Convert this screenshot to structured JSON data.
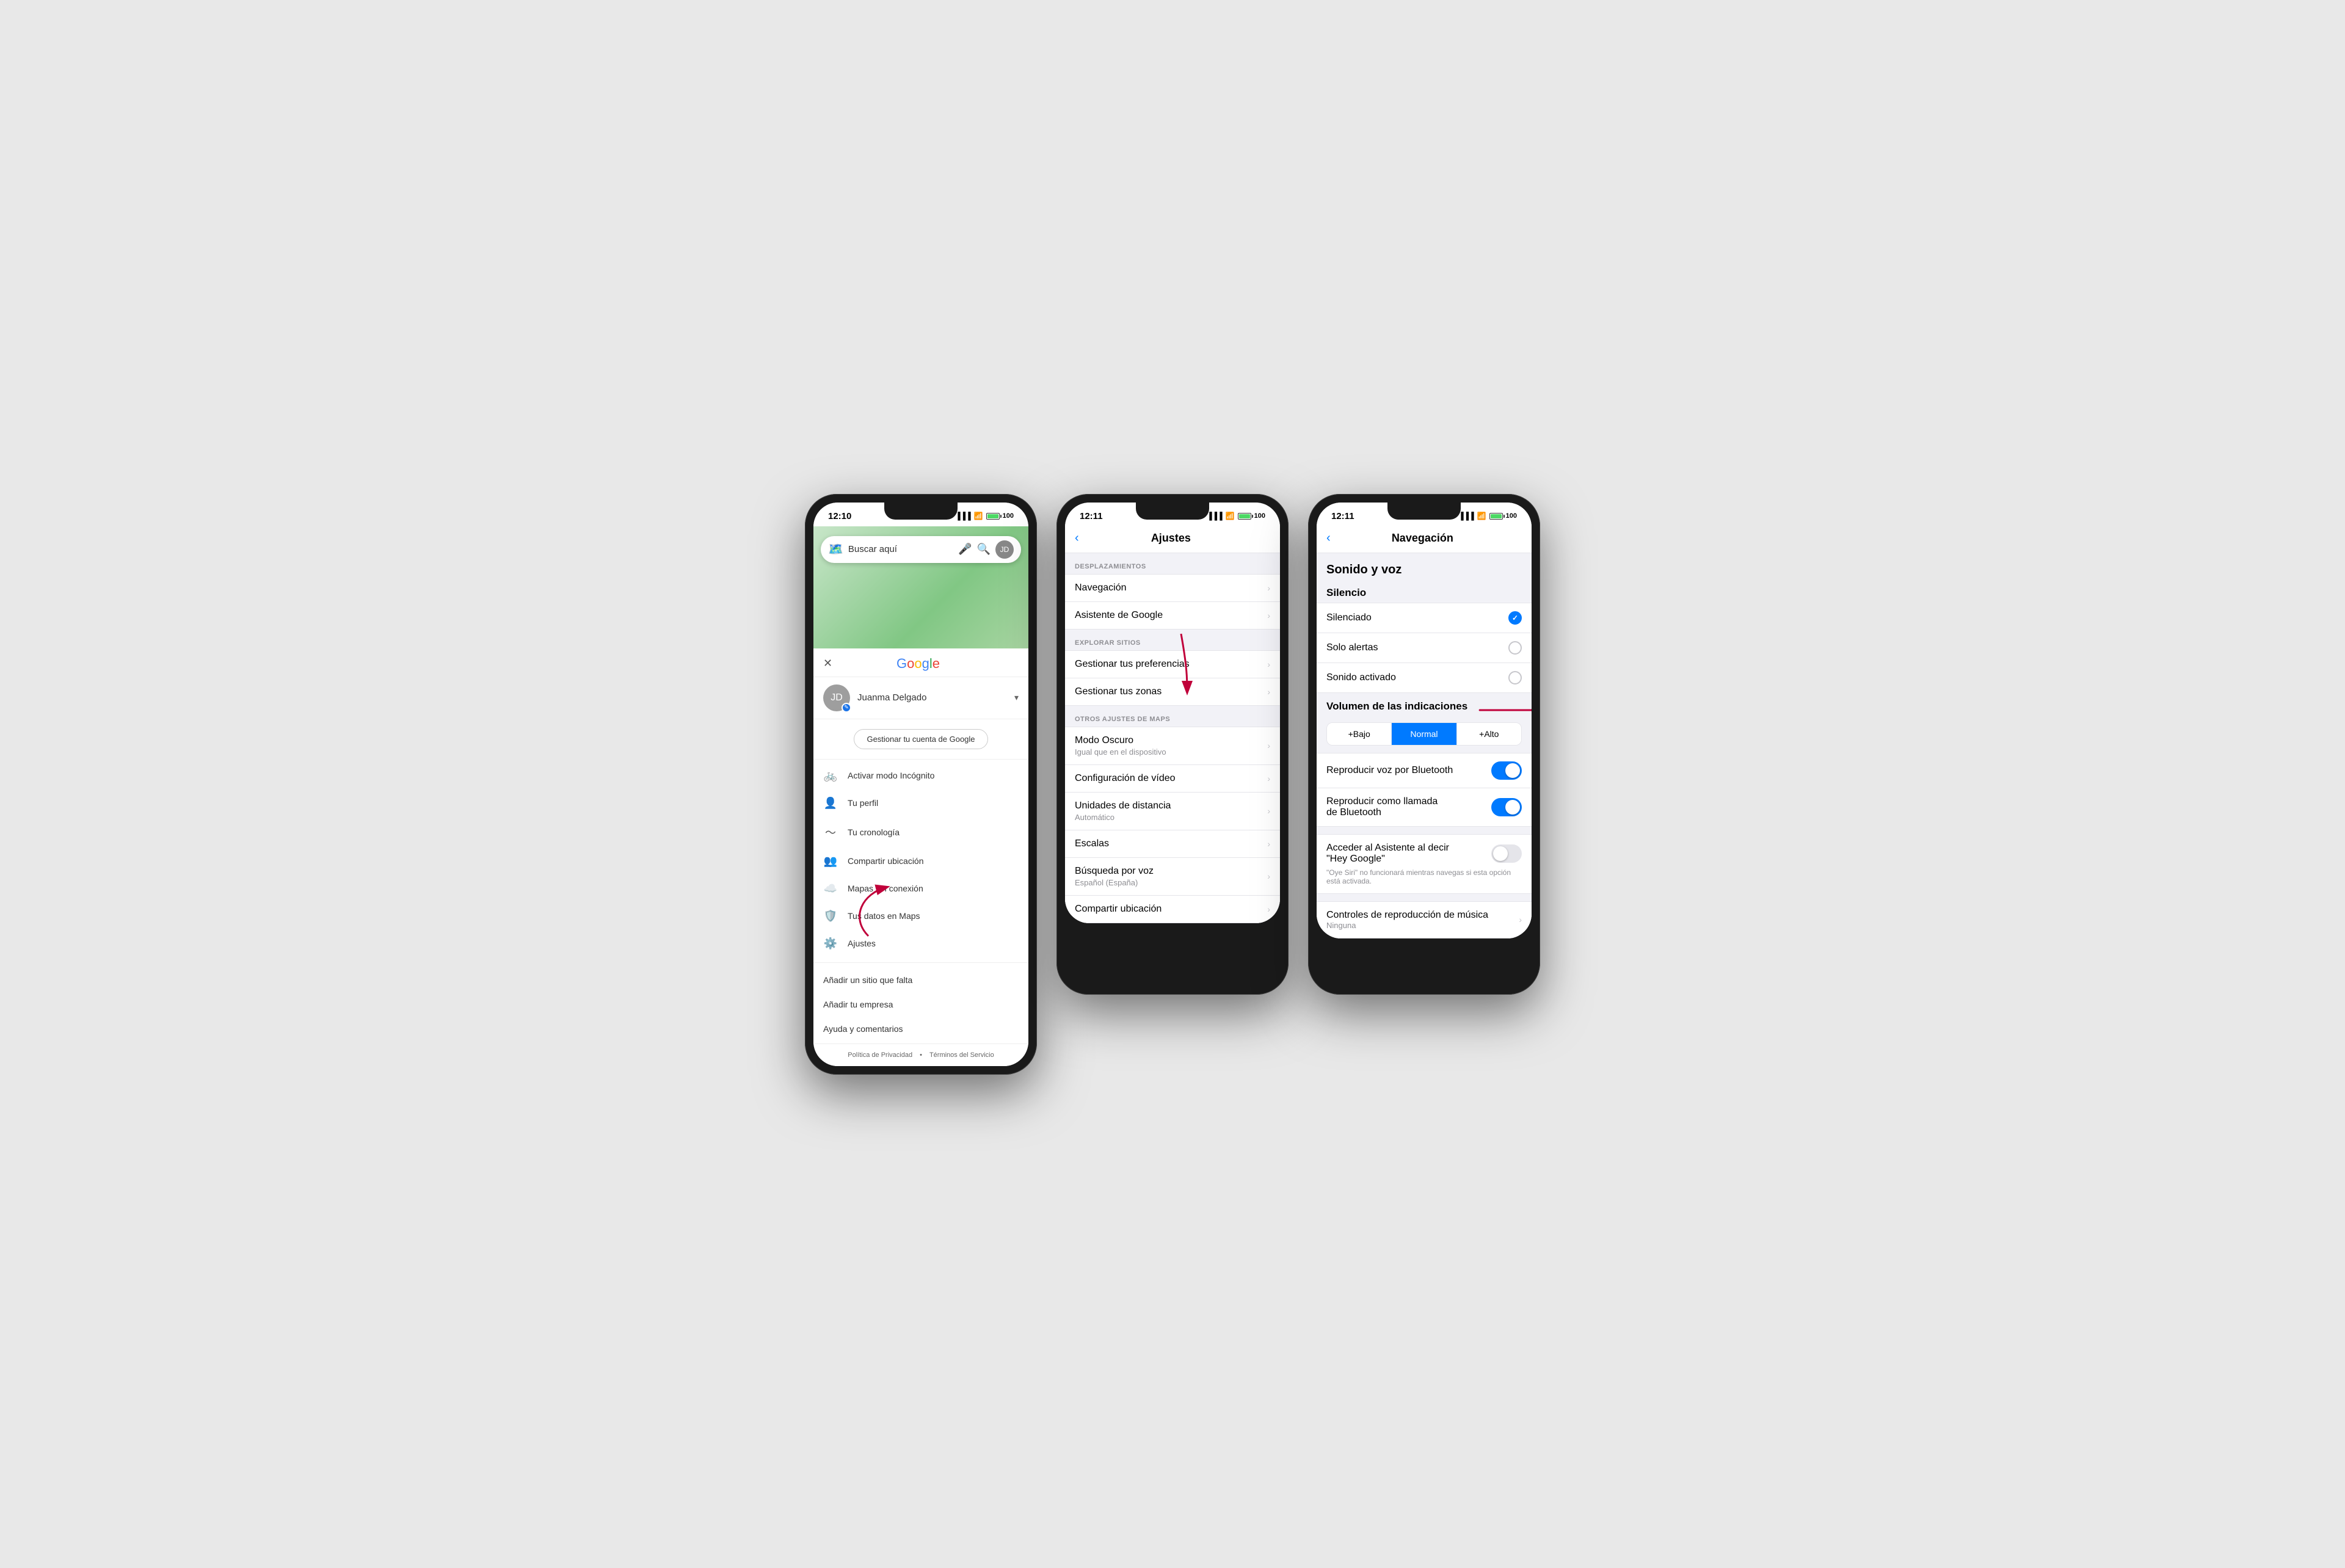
{
  "phones": {
    "phone1": {
      "status": {
        "time": "12:10",
        "signal": "▐▐▐",
        "wifi": "WiFi",
        "battery": "100"
      },
      "search_placeholder": "Buscar aquí",
      "user": {
        "name": "Juanma Delgado",
        "manage_btn": "Gestionar tu cuenta de Google"
      },
      "menu_items": [
        {
          "icon": "🚲",
          "label": "Activar modo Incógnito"
        },
        {
          "icon": "👤",
          "label": "Tu perfil"
        },
        {
          "icon": "📈",
          "label": "Tu cronología"
        },
        {
          "icon": "👥",
          "label": "Compartir ubicación"
        },
        {
          "icon": "☁️",
          "label": "Mapas sin conexión"
        },
        {
          "icon": "🛡️",
          "label": "Tus datos en Maps"
        },
        {
          "icon": "⚙️",
          "label": "Ajustes"
        }
      ],
      "extra_items": [
        "Añadir un sitio que falta",
        "Añadir tu empresa",
        "Ayuda y comentarios"
      ],
      "footer": {
        "privacy": "Política de Privacidad",
        "terms": "Términos del Servicio"
      }
    },
    "phone2": {
      "status": {
        "time": "12:11",
        "battery": "100"
      },
      "title": "Ajustes",
      "back_label": "‹",
      "sections": [
        {
          "label": "DESPLAZAMIENTOS",
          "items": [
            {
              "label": "Navegación",
              "sub": ""
            },
            {
              "label": "Asistente de Google",
              "sub": ""
            }
          ]
        },
        {
          "label": "EXPLORAR SITIOS",
          "items": [
            {
              "label": "Gestionar tus preferencias",
              "sub": ""
            },
            {
              "label": "Gestionar tus zonas",
              "sub": ""
            }
          ]
        },
        {
          "label": "OTROS AJUSTES DE MAPS",
          "items": [
            {
              "label": "Modo Oscuro",
              "sub": "Igual que en el dispositivo"
            },
            {
              "label": "Configuración de vídeo",
              "sub": ""
            },
            {
              "label": "Unidades de distancia",
              "sub": "Automático"
            },
            {
              "label": "Escalas",
              "sub": ""
            },
            {
              "label": "Búsqueda por voz",
              "sub": "Español (España)"
            },
            {
              "label": "Compartir ubicación",
              "sub": ""
            }
          ]
        }
      ]
    },
    "phone3": {
      "status": {
        "time": "12:11",
        "battery": "100"
      },
      "title": "Navegación",
      "back_label": "‹",
      "sections": {
        "sound_voice_title": "Sonido y voz",
        "silence_title": "Silencio",
        "silence_options": [
          {
            "label": "Silenciado",
            "checked": true
          },
          {
            "label": "Solo alertas",
            "checked": false
          },
          {
            "label": "Sonido activado",
            "checked": false
          }
        ],
        "volume_title": "Volumen de las indicaciones",
        "volume_options": [
          {
            "label": "+Bajo",
            "active": false
          },
          {
            "label": "Normal",
            "active": true
          },
          {
            "label": "+Alto",
            "active": false
          }
        ],
        "bluetooth_row1": "Reproducir voz por Bluetooth",
        "bluetooth_row2_line1": "Reproducir como llamada",
        "bluetooth_row2_line2": "de Bluetooth",
        "hey_google_line1": "Acceder al Asistente al decir",
        "hey_google_line2": "\"Hey Google\"",
        "hey_google_sub": "\"Oye Siri\" no funcionará mientras navegas si esta opción está activada.",
        "music_controls": "Controles de reproducción de música",
        "music_sub": "Ninguna"
      }
    }
  }
}
